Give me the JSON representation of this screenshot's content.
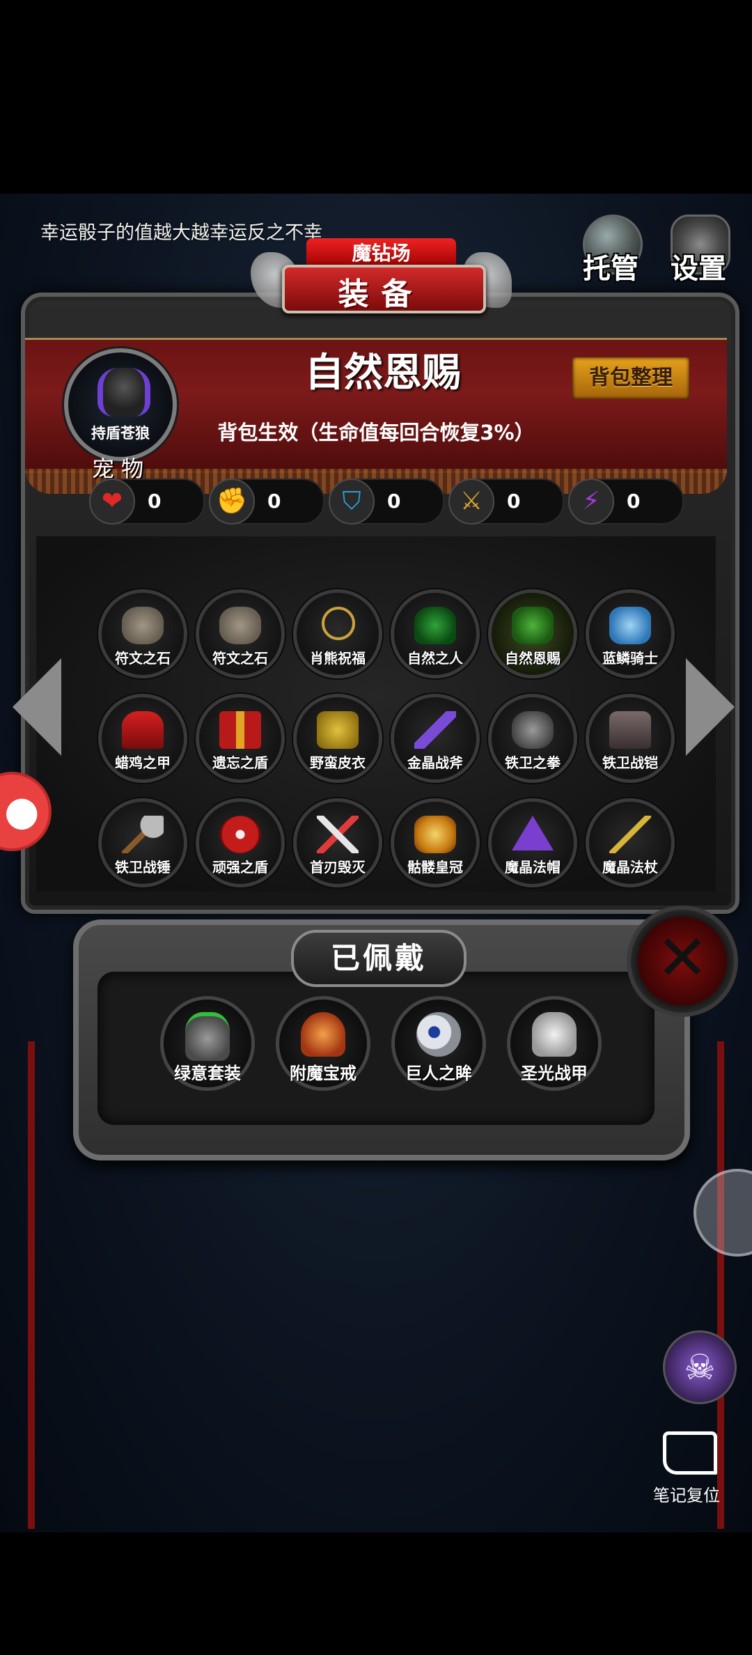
{
  "top_tip": "幸运骰子的值越大越幸运反之不幸",
  "banner": {
    "behind": "魔钻场",
    "title": "装备"
  },
  "top_buttons": {
    "auto": "托管",
    "settings": "设置"
  },
  "item": {
    "name": "自然恩赐",
    "effect": "背包生效（生命值每回合恢复3%）"
  },
  "sort_button": "背包整理",
  "pet": {
    "name": "持盾苍狼",
    "label": "宠 物"
  },
  "stats": [
    {
      "icon": "heart-icon",
      "value": "0"
    },
    {
      "icon": "strength-icon",
      "value": "0"
    },
    {
      "icon": "armor-icon",
      "value": "0"
    },
    {
      "icon": "sword-icon",
      "value": "0"
    },
    {
      "icon": "lightning-icon",
      "value": "0"
    }
  ],
  "inventory": [
    {
      "label": "符文之石",
      "icon": "rune-stone-icon"
    },
    {
      "label": "符文之石",
      "icon": "rune-stone-icon"
    },
    {
      "label": "肖熊祝福",
      "icon": "necklace-icon"
    },
    {
      "label": "自然之人",
      "icon": "nature-golem-icon"
    },
    {
      "label": "自然恩赐",
      "icon": "nature-gift-icon"
    },
    {
      "label": "蓝鳞骑士",
      "icon": "blue-knight-icon"
    },
    {
      "label": "蜡鸡之甲",
      "icon": "red-cloak-icon"
    },
    {
      "label": "遗忘之盾",
      "icon": "red-shield-icon"
    },
    {
      "label": "野蛮皮衣",
      "icon": "leopard-coat-icon"
    },
    {
      "label": "金晶战斧",
      "icon": "battle-axe-icon"
    },
    {
      "label": "铁卫之拳",
      "icon": "gauntlet-icon"
    },
    {
      "label": "铁卫战铠",
      "icon": "chest-armor-icon"
    },
    {
      "label": "铁卫战锤",
      "icon": "mace-icon"
    },
    {
      "label": "顽强之盾",
      "icon": "round-shield-icon"
    },
    {
      "label": "首刃毁灭",
      "icon": "crossed-blades-icon"
    },
    {
      "label": "骷髅皇冠",
      "icon": "skull-crown-icon"
    },
    {
      "label": "魔晶法帽",
      "icon": "wizard-hat-icon"
    },
    {
      "label": "魔晶法杖",
      "icon": "staff-icon"
    }
  ],
  "worn": {
    "title": "已佩戴",
    "items": [
      {
        "label": "绿意套装",
        "icon": "knight-suit-icon"
      },
      {
        "label": "附魔宝戒",
        "icon": "enchanted-ring-icon"
      },
      {
        "label": "巨人之眸",
        "icon": "giant-eye-icon"
      },
      {
        "label": "圣光战甲",
        "icon": "holy-armor-icon"
      }
    ]
  },
  "notes_button": "笔记复位",
  "colors": {
    "accent_red": "#7d1a1a",
    "gold": "#e6a21d",
    "frame": "#5a5a5a"
  }
}
